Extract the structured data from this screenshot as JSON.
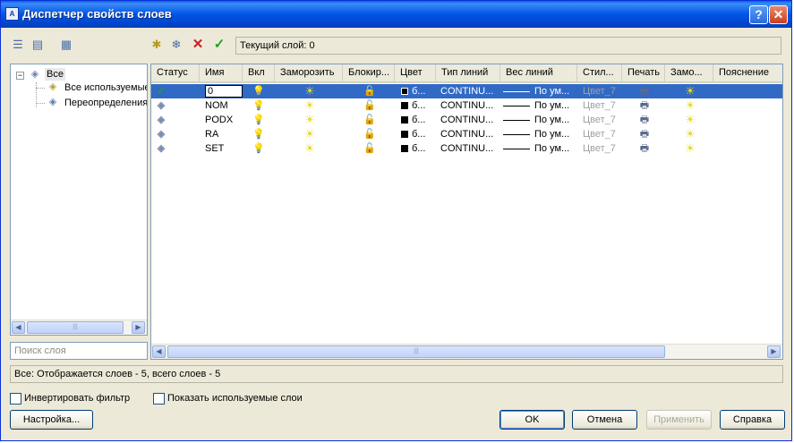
{
  "window": {
    "title": "Диспетчер свойств слоев",
    "icon": "layer-manager-icon",
    "help_glyph": "?",
    "close_glyph": "✕"
  },
  "toolbar_left": [
    {
      "name": "new-property-filter-icon",
      "glyph": "☰"
    },
    {
      "name": "new-group-filter-icon",
      "glyph": "▤"
    },
    {
      "name": "layer-states-icon",
      "glyph": "▦"
    }
  ],
  "toolbar_mid": [
    {
      "name": "new-layer-icon",
      "glyph": "✱"
    },
    {
      "name": "new-layer-frozen-icon",
      "glyph": "❄"
    },
    {
      "name": "delete-layer-icon",
      "glyph": "✕"
    },
    {
      "name": "set-current-icon",
      "glyph": "✓"
    }
  ],
  "current_layer": "Текущий слой: 0",
  "tree": {
    "expander": "−",
    "root": "Все",
    "children": [
      "Все используемые",
      "Переопределения"
    ]
  },
  "search": {
    "placeholder": "Поиск слоя"
  },
  "scroll": {
    "left": "◀",
    "right": "▶",
    "thumb": "|||"
  },
  "columns": [
    "Статус",
    "Имя",
    "Вкл",
    "Заморозить",
    "Блокир...",
    "Цвет",
    "Тип линий",
    "Вес линий",
    "Стил...",
    "Печать",
    "Замо...",
    "Пояснение"
  ],
  "layers": [
    {
      "status": "✓",
      "name": "0",
      "color": "б...",
      "linetype": "CONTINU...",
      "lineweight": "По ум...",
      "plotstyle": "Цвет_7",
      "selected": true
    },
    {
      "status": "",
      "name": "NOM",
      "color": "б...",
      "linetype": "CONTINU...",
      "lineweight": "По ум...",
      "plotstyle": "Цвет_7",
      "selected": false
    },
    {
      "status": "",
      "name": "PODX",
      "color": "б...",
      "linetype": "CONTINU...",
      "lineweight": "По ум...",
      "plotstyle": "Цвет_7",
      "selected": false
    },
    {
      "status": "",
      "name": "RA",
      "color": "б...",
      "linetype": "CONTINU...",
      "lineweight": "По ум...",
      "plotstyle": "Цвет_7",
      "selected": false
    },
    {
      "status": "",
      "name": "SET",
      "color": "б...",
      "linetype": "CONTINU...",
      "lineweight": "По ум...",
      "plotstyle": "Цвет_7",
      "selected": false
    }
  ],
  "icons": {
    "on": "💡",
    "freeze": "☀",
    "lock": "🔓",
    "plot": "🖶",
    "vp_freeze": "☀",
    "layer": "◈"
  },
  "status_text": "Все: Отображается слоев - 5, всего слоев - 5",
  "invert_filter": {
    "label": "Инвертировать фильтр",
    "checked": false
  },
  "show_used": {
    "label": "Показать используемые слои",
    "checked": false
  },
  "buttons": {
    "settings": "Настройка...",
    "ok": "OK",
    "cancel": "Отмена",
    "apply": "Применить",
    "help": "Справка"
  },
  "colors": {
    "selection": "#316ac5",
    "title_bar": "#0055e5",
    "dialog_bg": "#ece9d8",
    "bulb": "#f4e23a",
    "sun": "#e8d81e"
  }
}
